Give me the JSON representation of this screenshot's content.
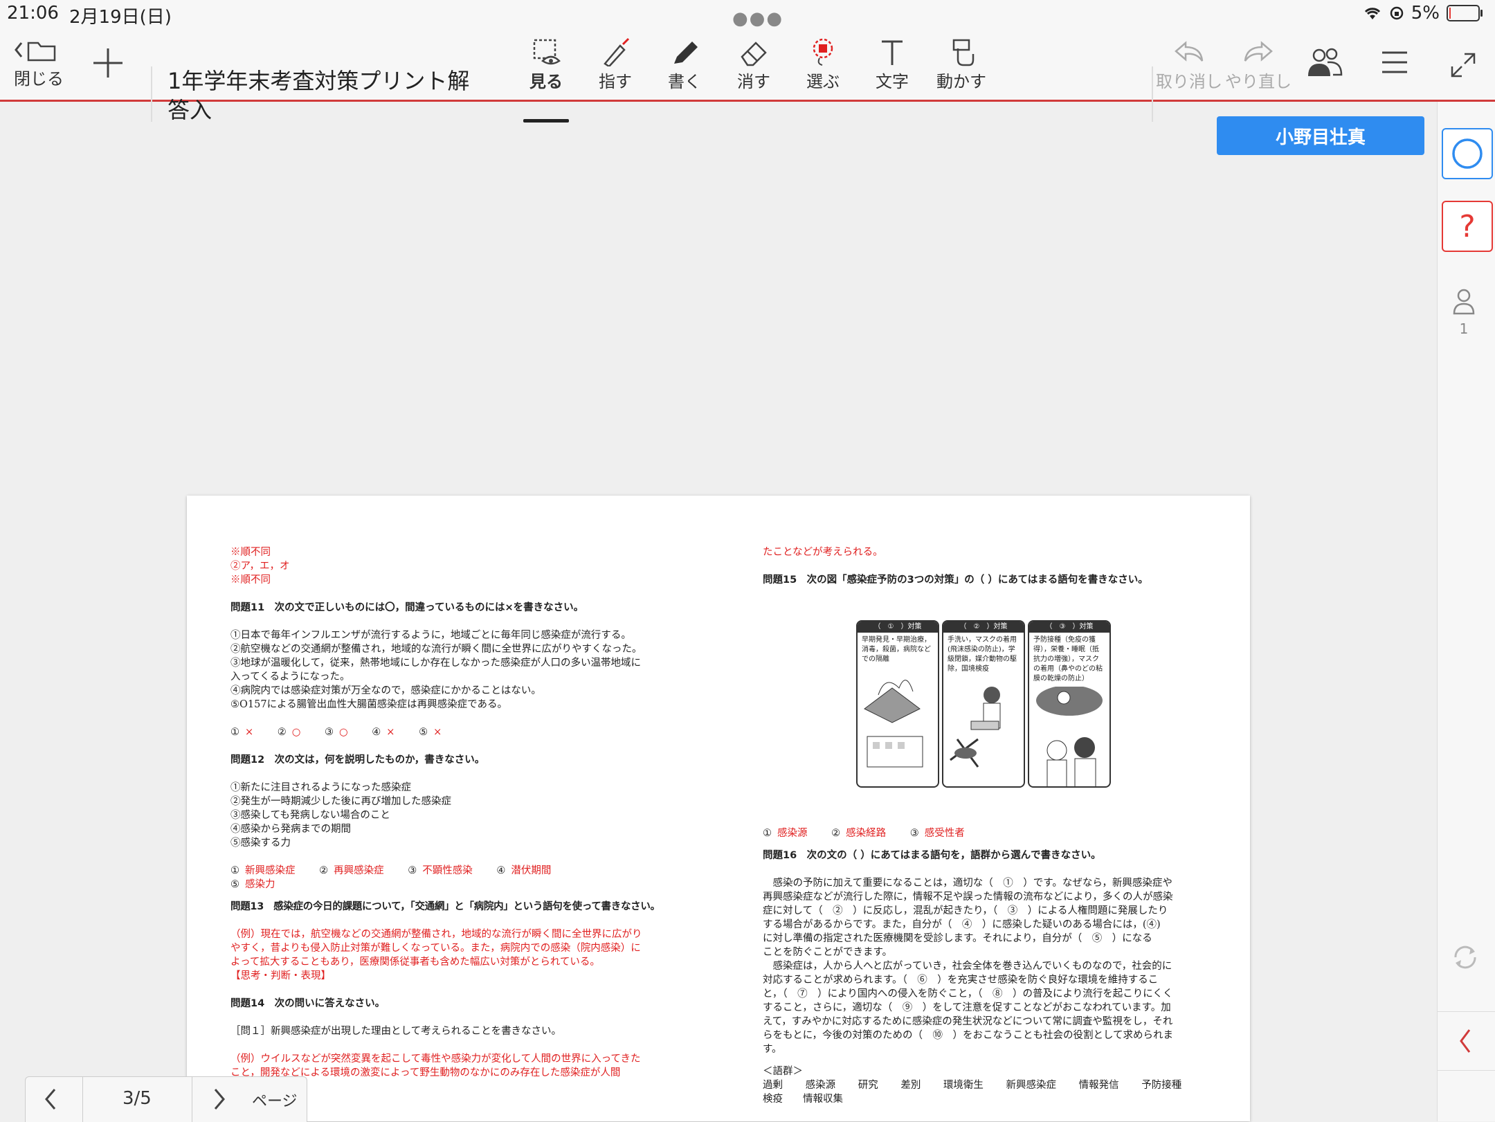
{
  "status": {
    "time": "21:06",
    "date": "2月19日(日)",
    "battery": "5%",
    "battery_level": 0.05
  },
  "toolbar": {
    "close_label": "閉じる",
    "doc_title_line1": "1年学年末考査対策プリント解",
    "doc_title_line2": "答入",
    "tools": {
      "view": "見る",
      "point": "指す",
      "write": "書く",
      "erase": "消す",
      "select": "選ぶ",
      "text": "文字",
      "move": "動かす"
    },
    "undo": "取り消し",
    "redo": "やり直し"
  },
  "student_name": "小野目壮真",
  "sidebar": {
    "user_count": "1"
  },
  "pager": {
    "current": "3/5",
    "label": "ページ"
  },
  "doc": {
    "left": {
      "red_top1": "※順不同",
      "red_top2": "②ア，エ，オ",
      "red_top3": "※順不同",
      "q11": "問題11　次の文で正しいものには〇，間違っているものには×を書きなさい。",
      "q11_items": [
        "①日本で毎年インフルエンザが流行するように，地域ごとに毎年同じ感染症が流行する。",
        "②航空機などの交通網が整備され，地域的な流行が瞬く間に全世界に広がりやすくなった。",
        "③地球が温暖化して，従来，熱帯地域にしか存在しなかった感染症が人口の多い温帯地域に",
        "入ってくるようになった。",
        "④病院内では感染症対策が万全なので，感染症にかかることはない。",
        "⑤O157による腸管出血性大腸菌感染症は再興感染症である。"
      ],
      "q11_ans": [
        {
          "n": "①",
          "a": "×"
        },
        {
          "n": "②",
          "a": "○"
        },
        {
          "n": "③",
          "a": "○"
        },
        {
          "n": "④",
          "a": "×"
        },
        {
          "n": "⑤",
          "a": "×"
        }
      ],
      "q12": "問題12　次の文は，何を説明したものか，書きなさい。",
      "q12_items": [
        "①新たに注目されるようになった感染症",
        "②発生が一時期減少した後に再び増加した感染症",
        "③感染しても発病しない場合のこと",
        "④感染から発病までの期間",
        "⑤感染する力"
      ],
      "q12_ans": [
        {
          "n": "①",
          "a": "新興感染症"
        },
        {
          "n": "②",
          "a": "再興感染症"
        },
        {
          "n": "③",
          "a": "不顕性感染"
        },
        {
          "n": "④",
          "a": "潜伏期間"
        }
      ],
      "q12_ans5": {
        "n": "⑤",
        "a": "感染力"
      },
      "q13": "問題13　感染症の今日的課題について，「交通網」と「病院内」という語句を使って書きなさい。",
      "q13_ans": [
        "（例）現在では，航空機などの交通網が整備され，地域的な流行が瞬く間に全世界に広がり",
        "やすく，昔よりも侵入防止対策が難しくなっている。また，病院内での感染（院内感染）に",
        "よって拡大することもあり，医療関係従事者も含めた幅広い対策がとられている。",
        "【思考・判断・表現】"
      ],
      "q14": "問題14　次の問いに答えなさい。",
      "q14_sub": "［問１］新興感染症が出現した理由として考えられることを書きなさい。",
      "q14_ans": [
        "（例）ウイルスなどが突然変異を起こして毒性や感染力が変化して人間の世界に入ってきた",
        "こと，開発などによる環境の激変によって野生動物のなかにのみ存在した感染症が人間"
      ]
    },
    "right": {
      "red_top": "たことなどが考えられる。",
      "q15": "問題15　次の図「感染症予防の3つの対策」の（ ）にあてはまる語句を書きなさい。",
      "panels": [
        {
          "head": "（　①　）対策",
          "text": "早期発見・早期治療，消毒，殺菌，病院などでの隔離"
        },
        {
          "head": "（　②　）対策",
          "text": "手洗い，マスクの着用(飛沫感染の防止)，学級閉鎖，媒介動物の駆除，国境検疫"
        },
        {
          "head": "（　③　）対策",
          "text": "予防接種（免疫の獲得），栄養・睡眠（抵抗力の増強），マスクの着用（鼻やのどの粘膜の乾燥の防止）"
        }
      ],
      "q15_ans": [
        {
          "n": "①",
          "a": "感染源"
        },
        {
          "n": "②",
          "a": "感染経路"
        },
        {
          "n": "③",
          "a": "感受性者"
        }
      ],
      "q16": "問題16　次の文の（ ）にあてはまる語句を，語群から選んで書きなさい。",
      "q16_text": [
        "　感染の予防に加えて重要になることは，適切な（　①　）です。なぜなら，新興感染症や",
        "再興感染症などが流行した際に，情報不足や誤った情報の流布などにより，多くの人が感染",
        "症に対して（　②　）に反応し，混乱が起きたり，（　③　）による人権問題に発展したり",
        "する場合があるからです。また，自分が（　④　）に感染した疑いのある場合には，(④)",
        "に対し準備の指定された医療機関を受診します。それにより，自分が（　⑤　）になる",
        "ことを防ぐことができます。",
        "　感染症は，人から人へと広がっていき，社会全体を巻き込んでいくものなので，社会的に",
        "対応することが求められます。（　⑥　）を充実させ感染を防ぐ良好な環境を維持するこ",
        "と，（　⑦　）により国内への侵入を防ぐこと，（　⑧　）の普及により流行を起こりにくく",
        "すること，さらに，適切な（　⑨　）をして注意を促すことなどがおこなわれています。加",
        "えて，すみやかに対応するために感染症の発生状況などについて常に調査や監視をし，それ",
        "らをもとに，今後の対策のための（　⑩　）をおこなうことも社会の役割として求められま",
        "す。"
      ],
      "group_head": "＜語群＞",
      "group": [
        "過剰",
        "感染源",
        "研究",
        "差別",
        "環境衛生",
        "新興感染症",
        "情報発信",
        "予防接種"
      ],
      "group2": "検疫　　情報収集"
    }
  },
  "colors": {
    "accent_red": "#d13b3b",
    "name_blue": "#2f8cf0",
    "answer_red": "#e02020"
  }
}
